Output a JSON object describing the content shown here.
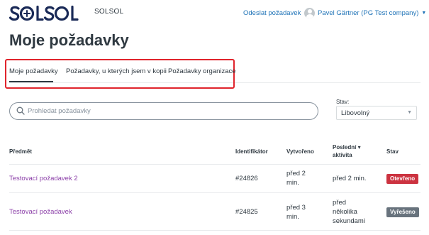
{
  "header": {
    "brand_name": "SOLSOL",
    "submit_link": "Odeslat požadavek",
    "user_name": "Pavel Gärtner (PG Test company)"
  },
  "page": {
    "title": "Moje požadavky"
  },
  "tabs": [
    {
      "label": "Moje požadavky",
      "active": true
    },
    {
      "label": "Požadavky, u kterých jsem v kopii",
      "active": false
    },
    {
      "label": "Požadavky organizace",
      "active": false
    }
  ],
  "search": {
    "placeholder": "Prohledat požadavky"
  },
  "filter": {
    "label": "Stav:",
    "value": "Libovolný"
  },
  "table": {
    "columns": {
      "subject": "Předmět",
      "identifier": "Identifikátor",
      "created": "Vytvořeno",
      "last_activity": "Poslední ▾ aktivita",
      "status": "Stav"
    },
    "rows": [
      {
        "subject": "Testovací požadavek 2",
        "identifier": "#24826",
        "created": "před 2 min.",
        "last_activity": "před 2 min.",
        "status": "Otevřeno",
        "status_color": "#cc3340"
      },
      {
        "subject": "Testovací požadavek",
        "identifier": "#24825",
        "created": "před 3 min.",
        "last_activity": "před několika sekundami",
        "status": "Vyřešeno",
        "status_color": "#68737d"
      }
    ]
  },
  "colors": {
    "link": "#1f73b7",
    "subject_link": "#8b3fa8",
    "logo": "#1a2a57",
    "highlight": "#e0242c"
  }
}
